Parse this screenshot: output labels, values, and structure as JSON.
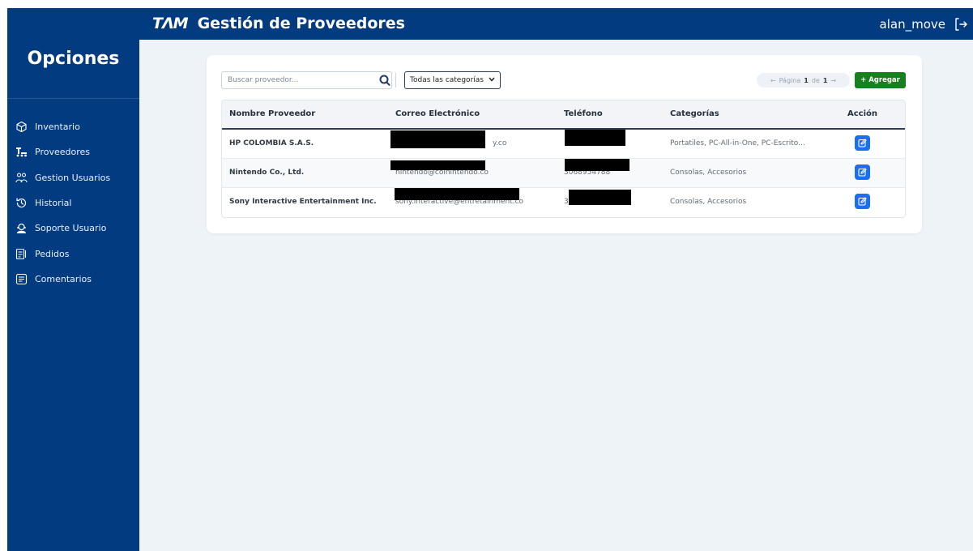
{
  "header": {
    "logo": "TΛM",
    "title": "Gestión de Proveedores",
    "username": "alan_move",
    "logout_icon": "logout-icon"
  },
  "sidebar": {
    "title": "Opciones",
    "items": [
      {
        "label": "Inventario",
        "icon": "box-icon"
      },
      {
        "label": "Proveedores",
        "icon": "supplier-icon"
      },
      {
        "label": "Gestion Usuarios",
        "icon": "users-icon"
      },
      {
        "label": "Historial",
        "icon": "history-icon"
      },
      {
        "label": "Soporte Usuario",
        "icon": "support-icon"
      },
      {
        "label": "Pedidos",
        "icon": "orders-icon"
      },
      {
        "label": "Comentarios",
        "icon": "comments-icon"
      }
    ]
  },
  "toolbar": {
    "search_placeholder": "Buscar proveedor...",
    "category_select": "Todas las categorías",
    "pager_prev": "←",
    "pager_page_word": "Página",
    "pager_current": "1",
    "pager_of": "de",
    "pager_total": "1",
    "pager_next": "→",
    "add_label": "+ Agregar"
  },
  "table": {
    "columns": [
      "Nombre Proveedor",
      "Correo Electrónico",
      "Teléfono",
      "Categorías",
      "Acción"
    ],
    "rows": [
      {
        "name": "HP COLOMBIA S.A.S.",
        "email": "y.co",
        "phone": "",
        "categories": "Portatiles, PC-All-in-One, PC-Escrito..."
      },
      {
        "name": "Nintendo Co., Ltd.",
        "email": "nintendo@colnintendo.co",
        "phone": "3068954788",
        "categories": "Consolas, Accesorios"
      },
      {
        "name": "Sony Interactive Entertainment Inc.",
        "email": "sony.interactive@entretainment.co",
        "phone": "3",
        "categories": "Consolas, Accesorios"
      }
    ]
  },
  "colors": {
    "primary": "#033b80",
    "background": "#eef3f8",
    "add_button": "#17811f",
    "edit_button": "#1a6ff0"
  }
}
